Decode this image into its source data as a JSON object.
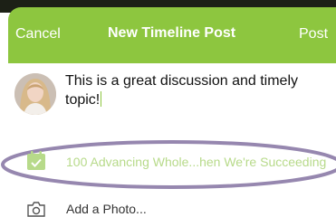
{
  "nav": {
    "cancel_label": "Cancel",
    "title": "New Timeline Post",
    "post_label": "Post"
  },
  "composer": {
    "text": "This is a great discussion and timely topic!"
  },
  "timeline": {
    "label": "100 Advancing Whole...hen We're Succeeding"
  },
  "attachments": {
    "photo_label": "Add a Photo..."
  },
  "colors": {
    "brand_green": "#8dc63f",
    "highlight_oval": "#8b7aa6"
  },
  "icons": {
    "calendar": "calendar-check-icon",
    "camera": "camera-icon"
  }
}
